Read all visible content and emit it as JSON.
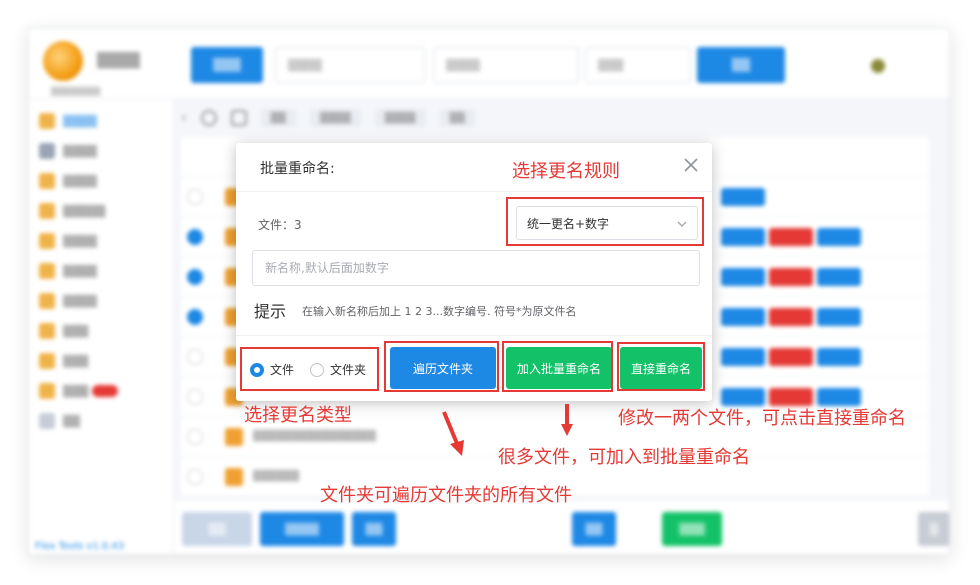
{
  "background_app": {
    "version_link": "Flex Tools v1.0.43"
  },
  "dialog": {
    "title": "批量重命名:",
    "file_count_label": "文件：3",
    "rule_select": {
      "value": "统一更名+数字"
    },
    "name_input": {
      "placeholder": "新名称,默认后面加数字",
      "value": ""
    },
    "tip_label": "提示",
    "tip_text": "在输入新名称后加上 1 2 3...数字编号. 符号*为原文件名",
    "type_options": [
      {
        "label": "文件",
        "checked": true
      },
      {
        "label": "文件夹",
        "checked": false
      }
    ],
    "buttons": {
      "traverse": "遍历文件夹",
      "add_batch": "加入批量重命名",
      "direct": "直接重命名"
    }
  },
  "annotations": {
    "choose_rule": "选择更名规则",
    "choose_type": "选择更名类型",
    "modify_few": "修改一两个文件，可点击直接重命名",
    "many_files": "很多文件，可加入到批量重命名",
    "folder_traverse": "文件夹可遍历文件夹的所有文件"
  },
  "colors": {
    "primary_blue": "#1e88e5",
    "green": "#13c268",
    "annotation_red": "#e53935"
  }
}
